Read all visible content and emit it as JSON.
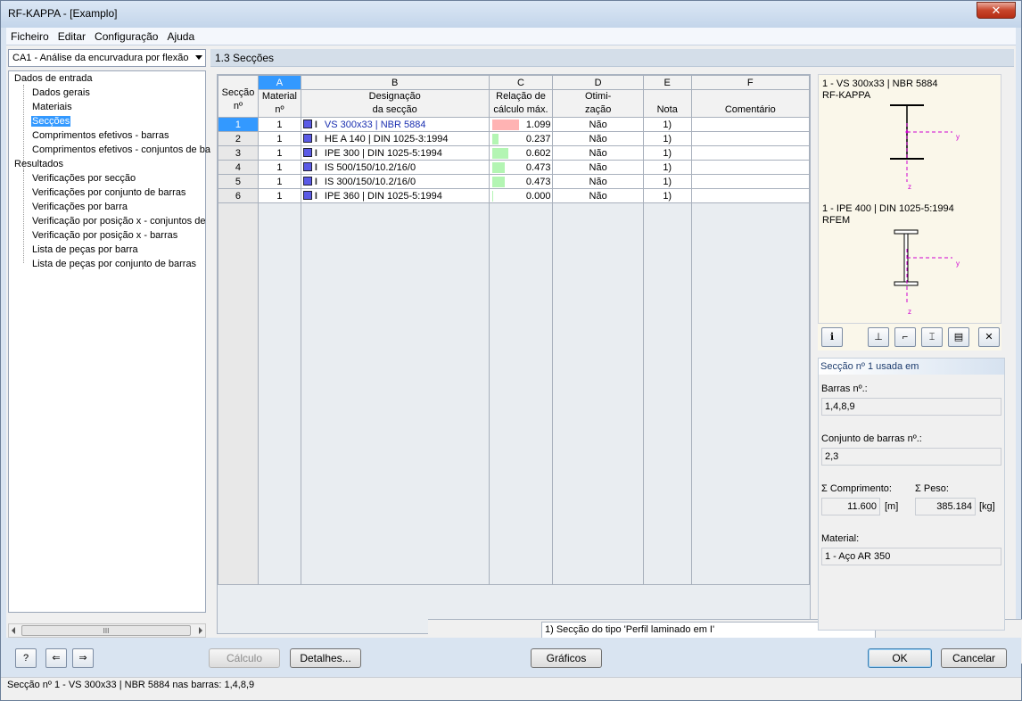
{
  "window": {
    "title": "RF-KAPPA - [Examplo]",
    "close": "✕"
  },
  "menu": [
    "Ficheiro",
    "Editar",
    "Configuração",
    "Ajuda"
  ],
  "case_combo": "CA1 - Análise da encurvadura por flexão",
  "tree": {
    "group_input": "Dados de entrada",
    "input_items": [
      "Dados gerais",
      "Materiais",
      "Secções",
      "Comprimentos efetivos - barras",
      "Comprimentos efetivos - conjuntos de ba"
    ],
    "group_results": "Resultados",
    "result_items": [
      "Verificações por secção",
      "Verificações por conjunto de barras",
      "Verificações por barra",
      "Verificação por posição x - conjuntos de",
      "Verificação por posição x - barras",
      "Lista de peças por barra",
      "Lista de peças por conjunto de barras"
    ]
  },
  "section_title": "1.3 Secções",
  "grid": {
    "col_letters": [
      "A",
      "B",
      "C",
      "D",
      "E",
      "F"
    ],
    "rowhdr_label": [
      "Secção",
      "nº"
    ],
    "headers": [
      [
        "Material",
        "nº"
      ],
      [
        "Designação",
        "da secção"
      ],
      [
        "Relação de",
        "cálculo máx."
      ],
      [
        "Otimi-",
        "zação"
      ],
      [
        "",
        "Nota"
      ],
      [
        "",
        "Comentário"
      ]
    ],
    "rows": [
      {
        "no": "1",
        "mat": "1",
        "desig": "VS 300x33 | NBR 5884",
        "ratio": "1.099",
        "ratio_val": 1.099,
        "opt": "Não",
        "note": "1)",
        "comment": ""
      },
      {
        "no": "2",
        "mat": "1",
        "desig": "HE A 140 | DIN 1025-3:1994",
        "ratio": "0.237",
        "ratio_val": 0.237,
        "opt": "Não",
        "note": "1)",
        "comment": ""
      },
      {
        "no": "3",
        "mat": "1",
        "desig": "IPE 300 | DIN 1025-5:1994",
        "ratio": "0.602",
        "ratio_val": 0.602,
        "opt": "Não",
        "note": "1)",
        "comment": ""
      },
      {
        "no": "4",
        "mat": "1",
        "desig": "IS 500/150/10.2/16/0",
        "ratio": "0.473",
        "ratio_val": 0.473,
        "opt": "Não",
        "note": "1)",
        "comment": ""
      },
      {
        "no": "5",
        "mat": "1",
        "desig": "IS 300/150/10.2/16/0",
        "ratio": "0.473",
        "ratio_val": 0.473,
        "opt": "Não",
        "note": "1)",
        "comment": ""
      },
      {
        "no": "6",
        "mat": "1",
        "desig": "IPE 360 | DIN 1025-5:1994",
        "ratio": "0.000",
        "ratio_val": 0.0,
        "opt": "Não",
        "note": "1)",
        "comment": ""
      }
    ],
    "colors": {
      "over": "#ffb3b3",
      "ok": "#b3f5b3"
    }
  },
  "footnote": "1) Secção do tipo 'Perfil laminado em I'",
  "preview": {
    "top_line1": "1 - VS 300x33 | NBR 5884",
    "top_line2": "RF-KAPPA",
    "bottom_line1": "1 - IPE 400 | DIN 1025-5:1994",
    "bottom_line2": "RFEM",
    "axis_y": "y",
    "axis_z": "z"
  },
  "used": {
    "header": "Secção nº 1 usada em",
    "bars_label": "Barras nº.:",
    "bars_value": "1,4,8,9",
    "sets_label": "Conjunto de barras nº.:",
    "sets_value": "2,3",
    "length_label": "Σ Comprimento:",
    "length_value": "11.600",
    "length_unit": "[m]",
    "weight_label": "Σ Peso:",
    "weight_value": "385.184",
    "weight_unit": "[kg]",
    "material_label": "Material:",
    "material_value": "1 - Aço AR 350"
  },
  "buttons": {
    "calc": "Cálculo",
    "details": "Detalhes...",
    "graphics": "Gráficos",
    "ok": "OK",
    "cancel": "Cancelar"
  },
  "status": "Secção nº 1 - VS 300x33 | NBR 5884 nas barras: 1,4,8,9"
}
